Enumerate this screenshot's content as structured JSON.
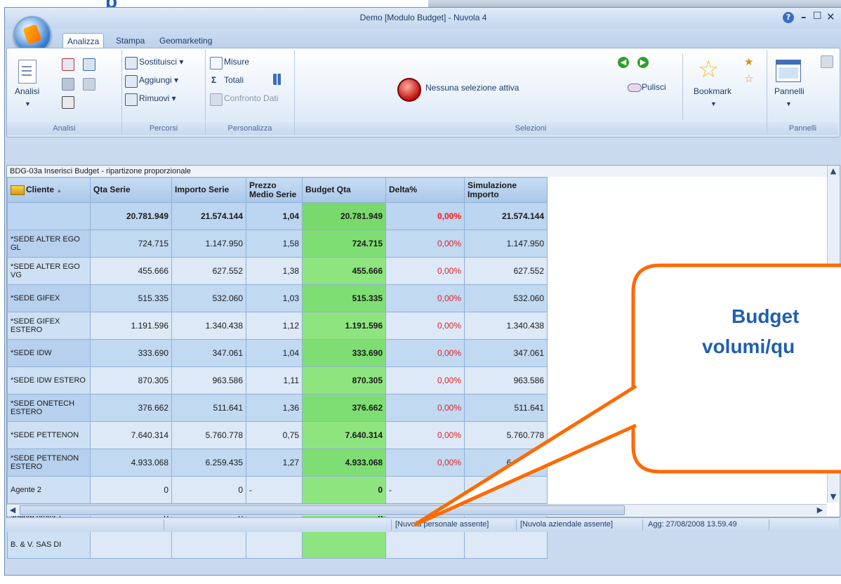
{
  "slide": {
    "title_fragment": "p"
  },
  "window": {
    "title": "Demo [Modulo Budget] - Nuvola 4",
    "help": "?",
    "minimize": "–",
    "maximize": "☐",
    "close": "✕"
  },
  "tabs": [
    "Analizza",
    "Stampa",
    "Geomarketing"
  ],
  "ribbon": {
    "analisi": {
      "big": "Analisi",
      "group": "Analisi"
    },
    "percorsi": {
      "sostituisci": "Sostituisci",
      "aggiungi": "Aggiungi",
      "rimuovi": "Rimuovi",
      "group": "Percorsi"
    },
    "personalizza": {
      "misure": "Misure",
      "totali": "Totali",
      "confronto": "Confronto Dati",
      "group": "Personalizza"
    },
    "selezioni": {
      "status": "Nessuna selezione attiva",
      "pulisci": "Pulisci",
      "bookmark": "Bookmark",
      "group": "Selezioni"
    },
    "pannelli": {
      "big": "Pannelli",
      "group": "Pannelli"
    }
  },
  "grid": {
    "caption": "BDG-03a Inserisci Budget - ripartizone proporzionale",
    "headers": [
      "Cliente",
      "Qta Serie",
      "Importo Serie",
      "Prezzo Medio Serie",
      "Budget Qta",
      "Delta%",
      "Simulazione Importo"
    ],
    "total": [
      "",
      "20.781.949",
      "21.574.144",
      "1,04",
      "20.781.949",
      "0,00%",
      "21.574.144"
    ],
    "rows": [
      [
        "*SEDE ALTER EGO GL",
        "724.715",
        "1.147.950",
        "1,58",
        "724.715",
        "0,00%",
        "1.147.950"
      ],
      [
        "*SEDE ALTER EGO VG",
        "455.666",
        "627.552",
        "1,38",
        "455.666",
        "0,00%",
        "627.552"
      ],
      [
        "*SEDE GIFEX",
        "515.335",
        "532.060",
        "1,03",
        "515.335",
        "0,00%",
        "532.060"
      ],
      [
        "*SEDE GIFEX ESTERO",
        "1.191.596",
        "1.340.438",
        "1,12",
        "1.191.596",
        "0,00%",
        "1.340.438"
      ],
      [
        "*SEDE IDW",
        "333.690",
        "347.061",
        "1,04",
        "333.690",
        "0,00%",
        "347.061"
      ],
      [
        "*SEDE IDW ESTERO",
        "870.305",
        "963.586",
        "1,11",
        "870.305",
        "0,00%",
        "963.586"
      ],
      [
        "*SEDE ONETECH ESTERO",
        "376.662",
        "511.641",
        "1,36",
        "376.662",
        "0,00%",
        "511.641"
      ],
      [
        "*SEDE PETTENON",
        "7.640.314",
        "5.760.778",
        "0,75",
        "7.640.314",
        "0,00%",
        "5.760.778"
      ],
      [
        "*SEDE PETTENON ESTERO",
        "4.933.068",
        "6.259.435",
        "1,27",
        "4.933.068",
        "0,00%",
        "6.259.435"
      ],
      [
        "Agente 2",
        "0",
        "0",
        "-",
        "0",
        "-",
        "-"
      ],
      [
        "agente prova 1",
        "0",
        "0",
        "-",
        "0",
        "-",
        "-"
      ],
      [
        "B. & V. SAS DI",
        "",
        "",
        "",
        "",
        "",
        ""
      ]
    ]
  },
  "status": {
    "personal": "[Nuvola personale assente]",
    "company": "[Nuvola aziendale assente]",
    "updated": "Agg: 27/08/2008 13.59.49"
  },
  "callout": {
    "line1": "Budget",
    "line2": "volumi/qu"
  },
  "colors": {
    "callout_orange": "#ff6a00",
    "callout_text": "#1f5fb0",
    "budget_green": "#7fde73",
    "delta_red": "#e02020"
  }
}
